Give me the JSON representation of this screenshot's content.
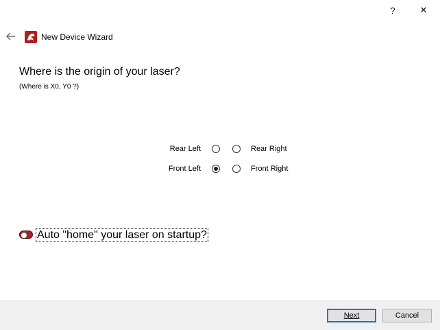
{
  "titlebar": {
    "help_glyph": "?",
    "close_glyph": "✕"
  },
  "header": {
    "title": "New Device Wizard",
    "back_icon": "back-arrow-icon",
    "app_icon": "lightburn-app-icon",
    "brand_color": "#b01e1e"
  },
  "main": {
    "question": "Where is the origin of your laser?",
    "subquestion": "(Where is X0, Y0 ?)",
    "origin_options": {
      "rear_left": "Rear Left",
      "rear_right": "Rear Right",
      "front_left": "Front Left",
      "front_right": "Front Right",
      "selected": "Front Left"
    },
    "auto_home": {
      "label": "Auto \"home\" your laser on startup?",
      "enabled": false
    }
  },
  "footer": {
    "next_label": "Next",
    "cancel_label": "Cancel",
    "accent_color": "#0078d7"
  }
}
